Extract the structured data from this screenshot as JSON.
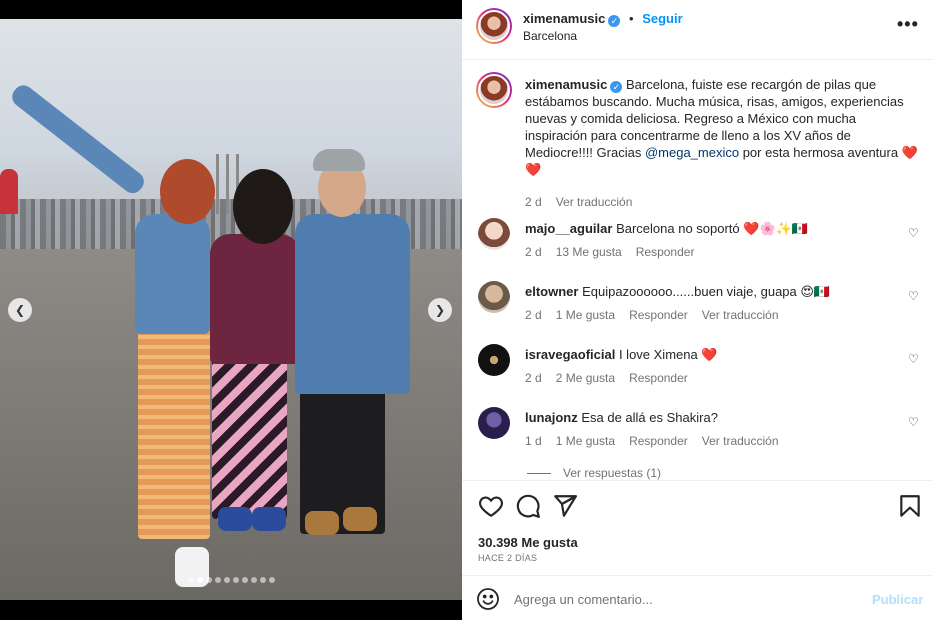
{
  "post": {
    "username": "ximenamusic",
    "verified": true,
    "follow_label": "Seguir",
    "separator": "•",
    "location": "Barcelona",
    "more_icon": "more-horizontal-icon"
  },
  "caption": {
    "username": "ximenamusic",
    "text": "Barcelona, fuiste ese recargón de pilas que estábamos buscando. Mucha música, risas, amigos, experiencias nuevas y comida deliciosa. Regreso a México con mucha inspiración para concentrarme de lleno a los XV años de Mediocre!!!! Gracias",
    "mention": "@mega_mexico",
    "text_after": "por esta hermosa aventura",
    "hearts": "❤️❤️",
    "time": "2 d",
    "translate_label": "Ver traducción"
  },
  "comments": [
    {
      "username": "majo__aguilar",
      "text": "Barcelona no soportó ❤️🌸✨🇲🇽",
      "time": "2 d",
      "likes": "13 Me gusta",
      "reply": "Responder",
      "translate": ""
    },
    {
      "username": "eltowner",
      "text": "Equipazoooooo......buen viaje, guapa 😍🇲🇽",
      "time": "2 d",
      "likes": "1 Me gusta",
      "reply": "Responder",
      "translate": "Ver traducción"
    },
    {
      "username": "isravegaoficial",
      "text": "I love Ximena ❤️",
      "time": "2 d",
      "likes": "2 Me gusta",
      "reply": "Responder",
      "translate": ""
    },
    {
      "username": "lunajonz",
      "text": "Esa de allá es Shakira?",
      "time": "1 d",
      "likes": "1 Me gusta",
      "reply": "Responder",
      "translate": "Ver traducción"
    }
  ],
  "view_replies": "Ver respuestas (1)",
  "actions": {
    "likes": "30.398 Me gusta",
    "when": "HACE 2 DÍAS"
  },
  "add_comment": {
    "placeholder": "Agrega un comentario...",
    "post_label": "Publicar"
  },
  "carousel": {
    "total": 10,
    "active": 1
  },
  "colors": {
    "accent": "#0095f6",
    "heart": "#ed4956",
    "muted": "#737373"
  }
}
